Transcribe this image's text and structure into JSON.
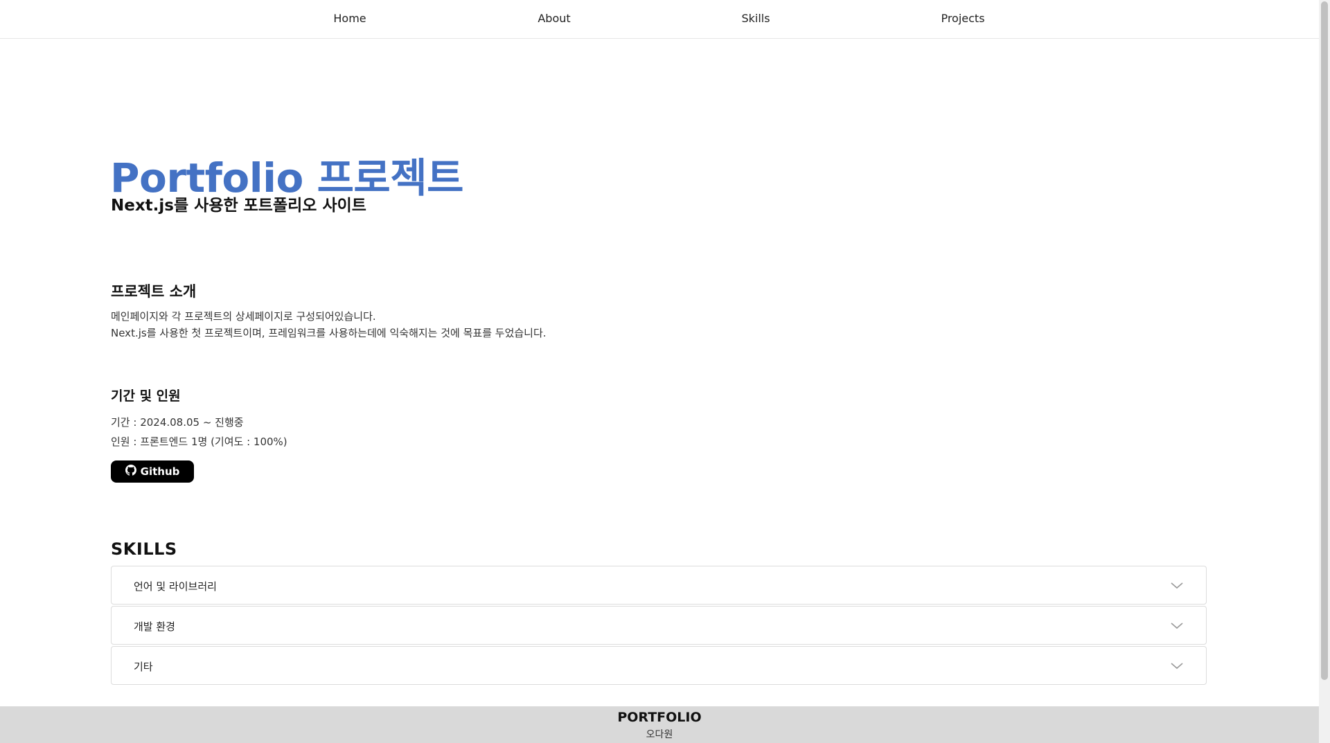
{
  "nav": {
    "items": [
      {
        "label": "Home"
      },
      {
        "label": "About"
      },
      {
        "label": "Skills"
      },
      {
        "label": "Projects"
      }
    ]
  },
  "hero": {
    "title": "Portfolio 프로젝트",
    "subtitle": "Next.js를 사용한 포트폴리오 사이트"
  },
  "intro": {
    "title": "프로젝트 소개",
    "lines": [
      "메인페이지와 각 프로젝트의 상세페이지로 구성되어있습니다.",
      "Next.js를 사용한 첫 프로젝트이며, 프레임워크를 사용하는데에 익숙해지는 것에 목표를 두었습니다."
    ]
  },
  "period": {
    "title": "기간 및 인원",
    "period_line": "기간 : 2024.08.05 ~ 진행중",
    "members_line": "인원 : 프론트엔드 1명 (기여도 : 100%)",
    "github_label": "Github",
    "github_icon": "github-icon"
  },
  "skills": {
    "title": "SKILLS",
    "items": [
      {
        "label": "언어 및 라이브러리",
        "icon": "chevron-down-icon"
      },
      {
        "label": "개발 환경",
        "icon": "chevron-down-icon"
      },
      {
        "label": "기타",
        "icon": "chevron-down-icon"
      }
    ]
  },
  "footer": {
    "title": "PORTFOLIO",
    "name": "오다원"
  },
  "colors": {
    "accent": "#4472c4",
    "button_bg": "#000000",
    "footer_bg": "#d9d9d9"
  }
}
